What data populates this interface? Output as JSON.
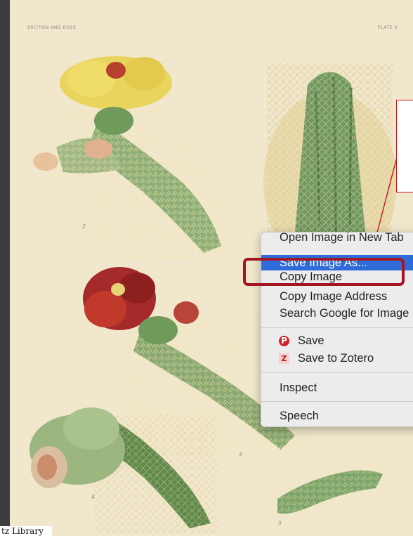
{
  "plate": {
    "header_left": "BRITTON AND ROSE",
    "header_right": "PLATE X",
    "figure_numbers": [
      "2",
      "3",
      "4",
      "5"
    ]
  },
  "context_menu": {
    "items": {
      "open_new_tab": "Open Image in New Tab",
      "save_image_as": "Save Image As...",
      "copy_image": "Copy Image",
      "copy_image_address": "Copy Image Address",
      "search_google": "Search Google for Image",
      "pinterest_save": "Save",
      "save_to_zotero": "Save to Zotero",
      "inspect": "Inspect",
      "speech": "Speech"
    },
    "highlighted_item": "save_image_as",
    "pinterest_icon_letter": "P",
    "zotero_icon_letter": "Z"
  },
  "library_label": "tz Library",
  "colors": {
    "plate_background": "#f1e7cd",
    "menu_highlight": "#2f6bd8",
    "annotation_red": "#a31521",
    "callout_red": "#c81818"
  }
}
